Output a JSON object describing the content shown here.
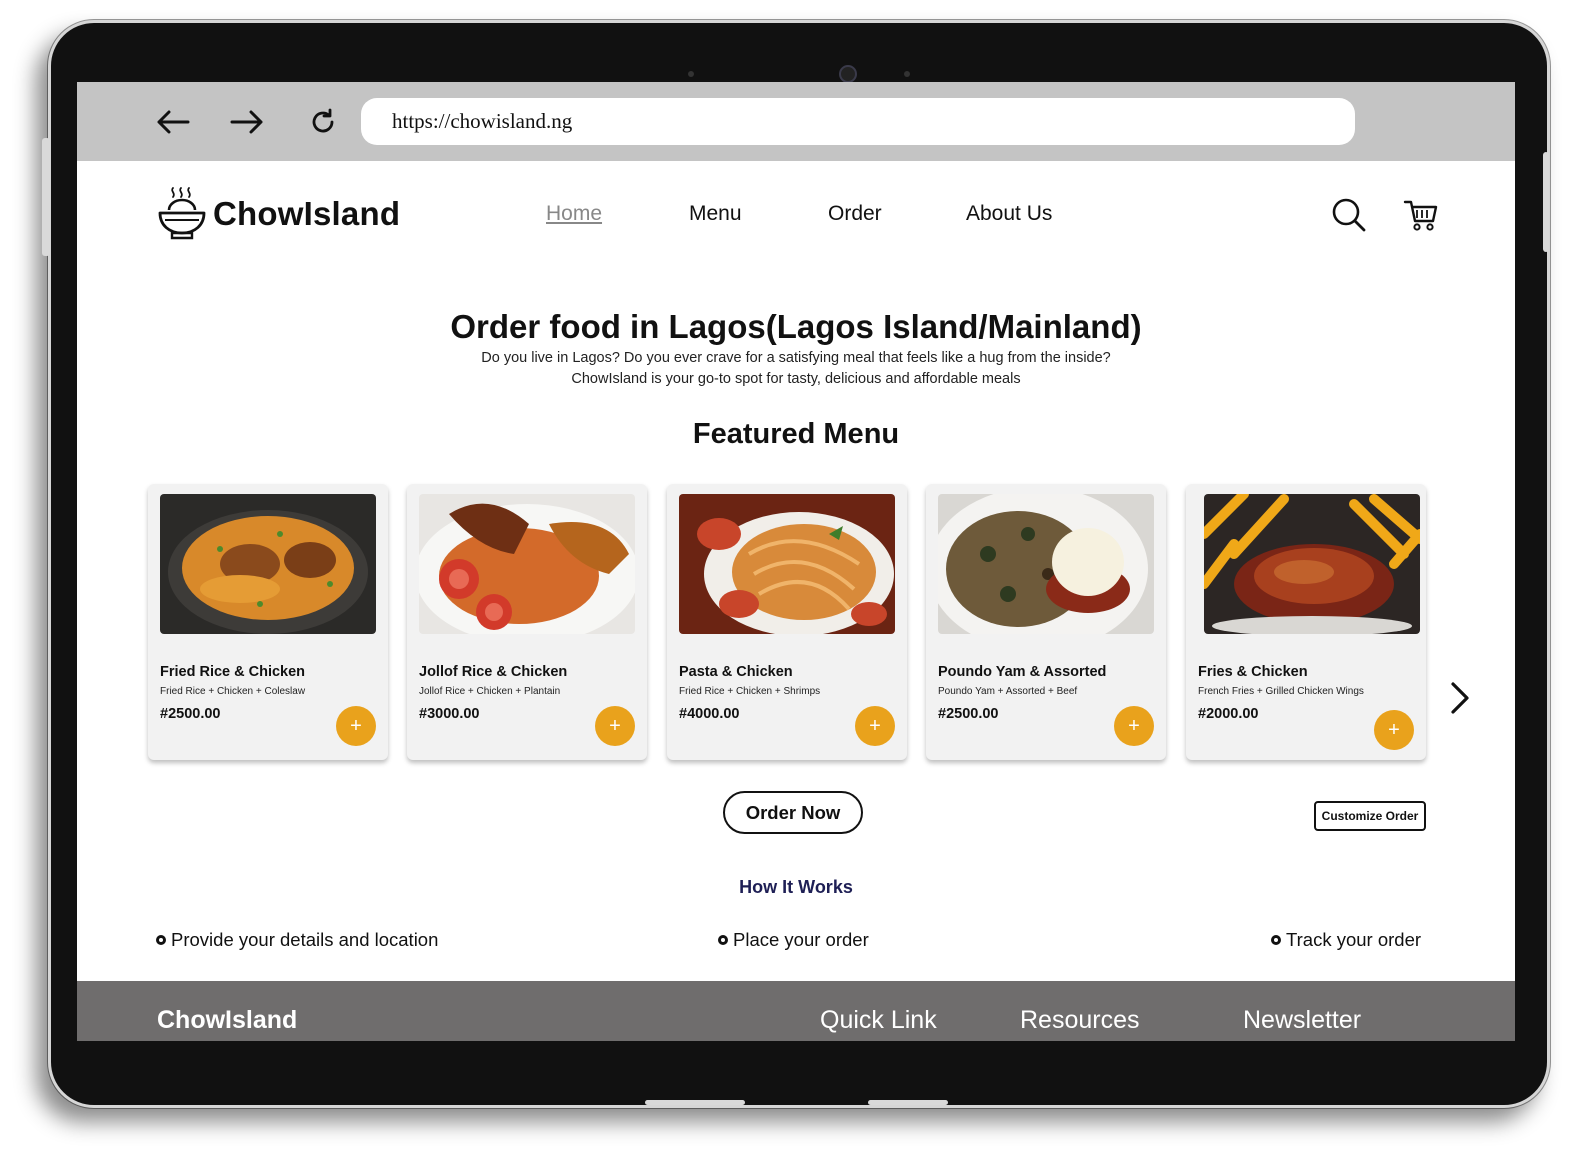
{
  "browser": {
    "url": "https://chowisland.ng",
    "icons": [
      "back-arrow-icon",
      "forward-arrow-icon",
      "reload-icon"
    ]
  },
  "header": {
    "brand": "ChowIsland",
    "logo_icon": "steaming-bowl-icon",
    "nav": [
      {
        "label": "Home",
        "active": true
      },
      {
        "label": "Menu",
        "active": false
      },
      {
        "label": "Order",
        "active": false
      },
      {
        "label": "About Us",
        "active": false
      }
    ],
    "icons": [
      "search-icon",
      "cart-icon"
    ]
  },
  "hero": {
    "title": "Order food in Lagos(Lagos Island/Mainland)",
    "subtitle_line1": "Do you live in Lagos? Do you ever crave for a satisfying meal that feels like a hug from the inside?",
    "subtitle_line2": "ChowIsland is your go-to spot for tasty, delicious and affordable meals"
  },
  "featured": {
    "title": "Featured Menu",
    "items": [
      {
        "name": "Fried Rice & Chicken",
        "desc": "Fried Rice + Chicken + Coleslaw",
        "price": "#2500.00",
        "add_label": "+"
      },
      {
        "name": "Jollof Rice & Chicken",
        "desc": "Jollof Rice + Chicken + Plantain",
        "price": "#3000.00",
        "add_label": "+"
      },
      {
        "name": "Pasta & Chicken",
        "desc": "Fried Rice + Chicken + Shrimps",
        "price": "#4000.00",
        "add_label": "+"
      },
      {
        "name": "Poundo Yam & Assorted",
        "desc": "Poundo Yam + Assorted + Beef",
        "price": "#2500.00",
        "add_label": "+"
      },
      {
        "name": "Fries & Chicken",
        "desc": "French Fries + Grilled Chicken Wings",
        "price": "#2000.00",
        "add_label": "+"
      }
    ],
    "next_icon": "chevron-right-icon"
  },
  "actions": {
    "order_now": "Order Now",
    "customize": "Customize Order"
  },
  "how_it_works": {
    "title": "How It Works",
    "steps": [
      "Provide your details and location",
      "Place your order",
      "Track your order"
    ]
  },
  "footer": {
    "brand": "ChowIsland",
    "columns": [
      "Quick Link",
      "Resources",
      "Newsletter"
    ]
  },
  "colors": {
    "accent": "#e9a21c",
    "how_title": "#1e1f55",
    "footer_bg": "#6f6d6d",
    "browser_bar": "#c4c4c4",
    "card_bg": "#f2f2f2"
  }
}
